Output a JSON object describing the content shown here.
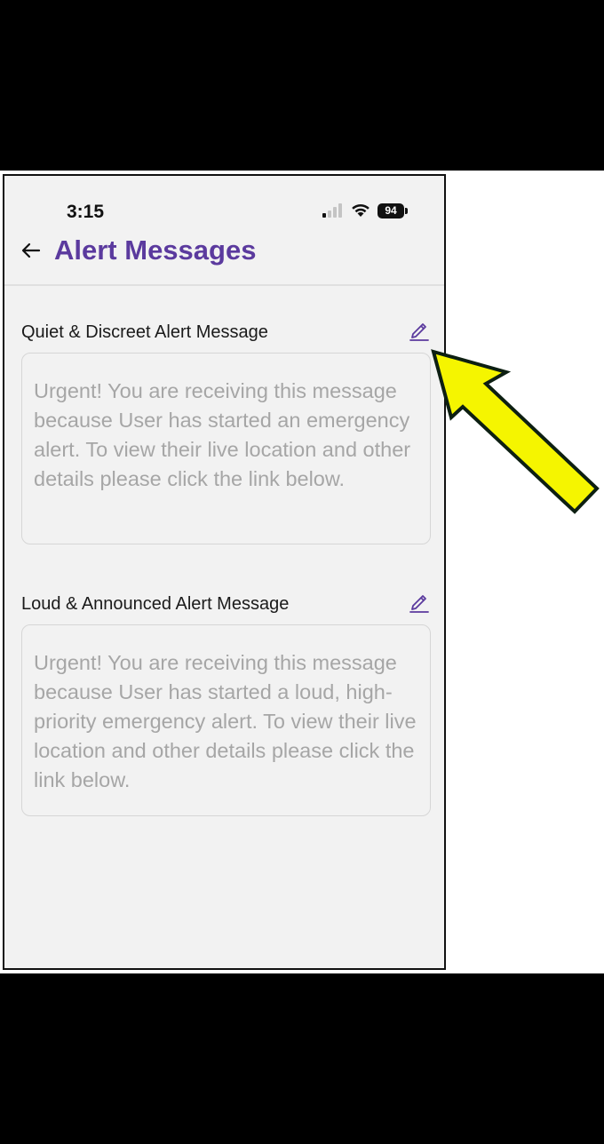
{
  "status_bar": {
    "time": "3:15",
    "battery": "94"
  },
  "header": {
    "title": "Alert Messages"
  },
  "sections": [
    {
      "label": "Quiet & Discreet Alert Message",
      "message": "Urgent! You are receiving this message because User has started an emergency alert. To view their live location and other details please click the link below."
    },
    {
      "label": "Loud & Announced Alert Message",
      "message": "Urgent! You are receiving this message because User has started a loud, high-priority emergency alert. To view their live location and other details please click the link below."
    }
  ],
  "colors": {
    "accent": "#5b3a9e",
    "background": "#f2f2f2",
    "placeholder_text": "#a6a6a6",
    "annotation_arrow": "#f5f500"
  },
  "icons": {
    "back": "arrow-left-icon",
    "edit": "pencil-icon",
    "signal": "cellular-signal-icon",
    "wifi": "wifi-icon",
    "battery": "battery-icon",
    "annotation": "yellow-arrow-pointer"
  }
}
